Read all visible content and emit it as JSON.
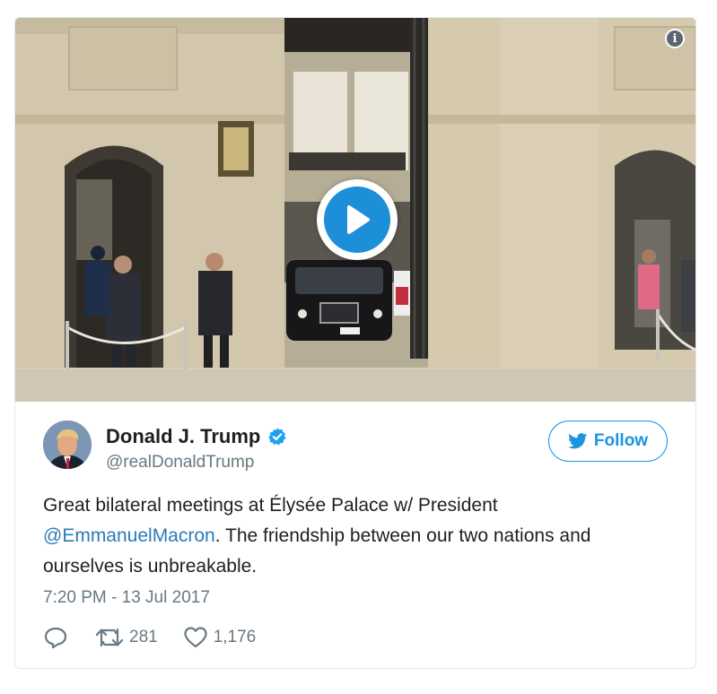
{
  "media": {
    "info_icon": "info-icon",
    "play_icon": "play-icon",
    "play_color": "#1d8ed8"
  },
  "tweet": {
    "author": {
      "display_name": "Donald J. Trump",
      "handle": "@realDonaldTrump",
      "verified_icon": "verified-badge-icon",
      "verified_color": "#1da1f2"
    },
    "follow_button": {
      "label": "Follow",
      "icon": "twitter-bird-icon",
      "color": "#1b95e0"
    },
    "text": {
      "part1": "Great bilateral meetings at Élysée Palace w/ President ",
      "mention": "@EmmanuelMacron",
      "part2": ". The friendship between our two nations and ourselves is unbreakable."
    },
    "timestamp": "7:20 PM - 13 Jul 2017",
    "actions": {
      "reply_icon": "reply-icon",
      "retweet_icon": "retweet-icon",
      "retweet_count": "281",
      "like_icon": "heart-icon",
      "like_count": "1,176"
    }
  }
}
